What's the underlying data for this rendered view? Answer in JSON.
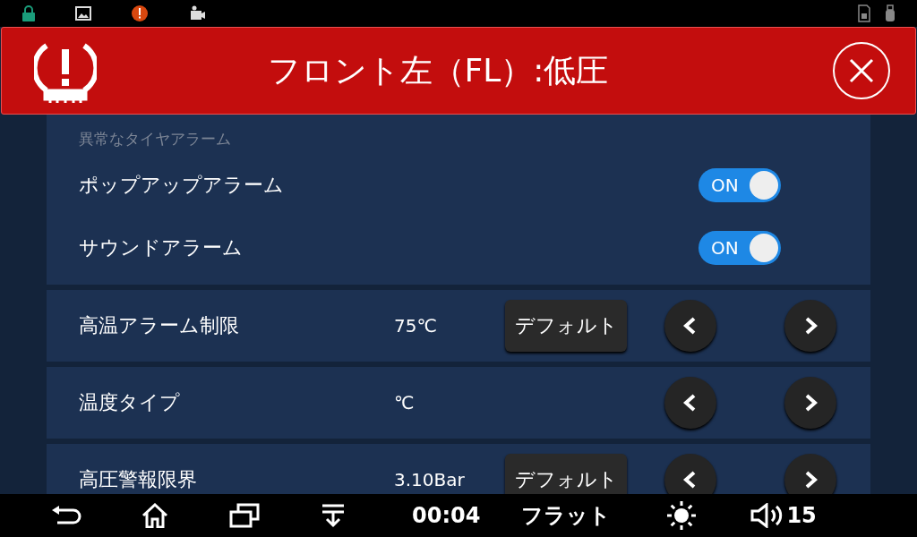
{
  "alert": {
    "message": "フロント左（FL）:低圧"
  },
  "alarm_panel": {
    "heading": "異常なタイヤアラーム",
    "toggles": [
      {
        "label": "ポップアップアラーム",
        "on": true,
        "state_text": "ON"
      },
      {
        "label": "サウンドアラーム",
        "on": true,
        "state_text": "ON"
      }
    ]
  },
  "settings": [
    {
      "label": "高温アラーム制限",
      "value": "75℃",
      "default_button": "デフォルト"
    },
    {
      "label": "温度タイプ",
      "value": "℃"
    },
    {
      "label": "高圧警報限界",
      "value": "3.10Bar",
      "default_button": "デフォルト"
    }
  ],
  "nav_bar": {
    "time": "00:04",
    "mode": "フラット",
    "volume": "15"
  }
}
